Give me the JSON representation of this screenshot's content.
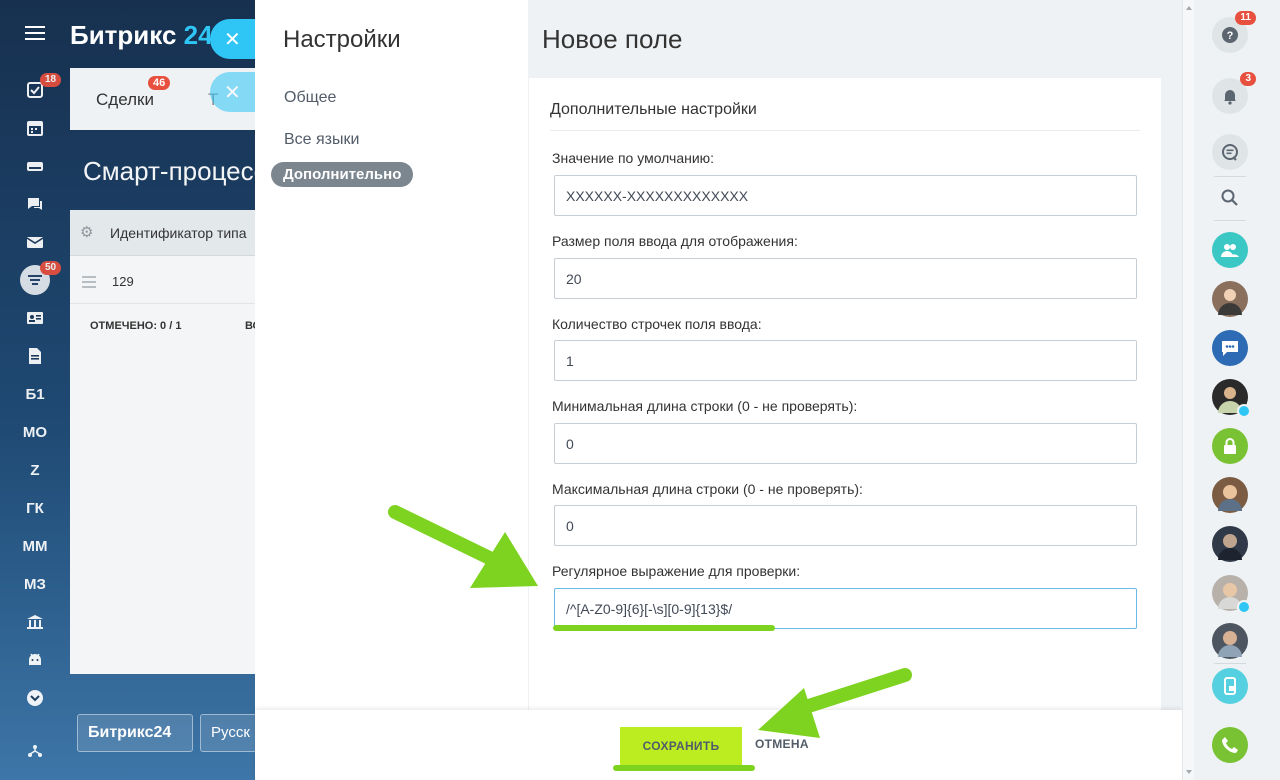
{
  "background": {
    "brand_name": "Битрикс",
    "brand_num": "24",
    "nav": [
      {
        "icon": "tasks-icon",
        "badge": "18"
      },
      {
        "icon": "calendar-icon"
      },
      {
        "icon": "drive-icon"
      },
      {
        "icon": "chat-icon"
      },
      {
        "icon": "mail-icon"
      },
      {
        "icon": "funnel-icon",
        "badge": "50"
      },
      {
        "icon": "contact-card-icon"
      },
      {
        "icon": "document-icon"
      },
      {
        "label": "Б1"
      },
      {
        "label": "МО"
      },
      {
        "label": "Z"
      },
      {
        "label": "ГК"
      },
      {
        "label": "ММ"
      },
      {
        "label": "МЗ"
      },
      {
        "icon": "bank-icon"
      },
      {
        "icon": "android-icon"
      },
      {
        "icon": "chevron-down-icon"
      },
      {
        "icon": "sitemap-icon"
      }
    ],
    "tab_label": "Сделки",
    "tab_badge": "46",
    "tab_partial": "Т",
    "page_title": "Смарт-процесс",
    "grid_header": "Идентификатор типа",
    "grid_value": "129",
    "grid_marked": "ОТМЕЧЕНО: 0 / 1",
    "grid_marked_b": "ВС",
    "footer_brand": "Битрикс24",
    "footer_lang": "Русск"
  },
  "settings": {
    "heading": "Настройки",
    "menu": [
      "Общее",
      "Все языки",
      "Дополнительно"
    ],
    "active_menu": "Дополнительно"
  },
  "form": {
    "title": "Новое поле",
    "section_title": "Дополнительные настройки",
    "fields": [
      {
        "label": "Значение по умолчанию:",
        "value": "XXXXXX-XXXXXXXXXXXXX"
      },
      {
        "label": "Размер поля ввода для отображения:",
        "value": "20"
      },
      {
        "label": "Количество строчек поля ввода:",
        "value": "1"
      },
      {
        "label": "Минимальная длина строки (0 - не проверять):",
        "value": "0"
      },
      {
        "label": "Максимальная длина строки (0 - не проверять):",
        "value": "0"
      },
      {
        "label": "Регулярное выражение для проверки:",
        "value": "/^[A-Z0-9]{6}[-\\s][0-9]{13}$/"
      }
    ],
    "save_label": "СОХРАНИТЬ",
    "cancel_label": "ОТМЕНА"
  },
  "right_panel": {
    "help_badge": "11",
    "notifications_badge": "3"
  },
  "colors": {
    "accent_green": "#bbed21",
    "arrow_green": "#7ed321",
    "slider_close": "#2fc6f6",
    "badge_red": "#e7503e"
  }
}
